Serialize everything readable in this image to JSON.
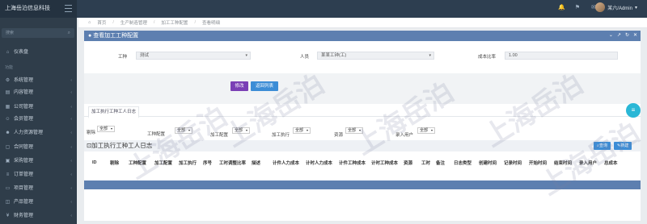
{
  "topbar": {
    "brand": "上海岳泊信息科技",
    "user_name": "某六/Admin"
  },
  "sidebar": {
    "search_placeholder": "搜索",
    "section": "功能",
    "items": [
      {
        "label": "仪表盘"
      },
      {
        "label": "系统管理"
      },
      {
        "label": "内容管理"
      },
      {
        "label": "公司管理"
      },
      {
        "label": "会员管理"
      },
      {
        "label": "人力资源管理"
      },
      {
        "label": "合同管理"
      },
      {
        "label": "采购管理"
      },
      {
        "label": "订单管理"
      },
      {
        "label": "项目管理"
      },
      {
        "label": "产品管理"
      },
      {
        "label": "财务管理"
      }
    ]
  },
  "breadcrumb": [
    "首页",
    "生产制造管理",
    "加工工种配置",
    "查看明细"
  ],
  "panel": {
    "title": "查看加工工种配置",
    "fields": {
      "work_type_label": "工种",
      "work_type_value": "测试",
      "person_label": "人员",
      "person_value": "某某工钟(工)",
      "cost_ratio_label": "成本比率",
      "cost_ratio_value": "1.00"
    },
    "buttons": {
      "edit": "修改",
      "back": "返回列表"
    },
    "tab": "加工执行工种工人日志",
    "filters": [
      {
        "label": "剔除",
        "value": "全部"
      },
      {
        "label": "工种配置",
        "value": "全部"
      },
      {
        "label": "加工配置",
        "value": "全部"
      },
      {
        "label": "加工执行",
        "value": "全部"
      },
      {
        "label": "资源",
        "value": "全部"
      },
      {
        "label": "录入用户",
        "value": "全部"
      }
    ],
    "sub_title": "加工执行工种工人日志",
    "sub_buttons": {
      "search": "查询",
      "new": "新建"
    },
    "columns": [
      "ID",
      "剔除",
      "工种配置",
      "加工配置",
      "加工执行",
      "序号",
      "工时调整比率",
      "描述",
      "计件人力成本",
      "计时人力成本",
      "计件工种成本",
      "计时工种成本",
      "资源",
      "工时",
      "备注",
      "日志类型",
      "创建时间",
      "记录时间",
      "开始时间",
      "结束时间",
      "录入用户",
      "总成本"
    ]
  },
  "watermark": "上海岳泊"
}
